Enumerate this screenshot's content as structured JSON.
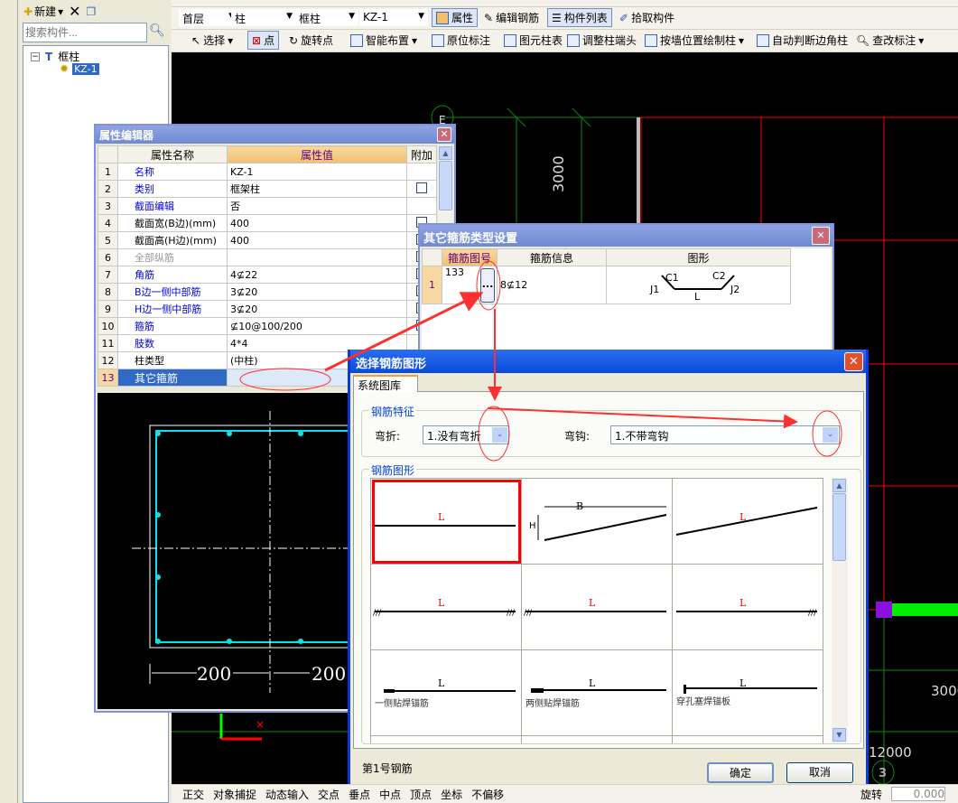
{
  "left_panel": {
    "new_label": "新建",
    "search_placeholder": "搜索构件...",
    "tree": {
      "root": "框柱",
      "child": "KZ-1"
    }
  },
  "toolbar1": {
    "floor": "首层",
    "type": "柱",
    "subtype": "框柱",
    "component": "KZ-1",
    "buttons": [
      "属性",
      "编辑钢筋",
      "构件列表",
      "拾取构件"
    ]
  },
  "toolbar2": {
    "buttons": [
      "选择",
      "点",
      "旋转点",
      "智能布置",
      "原位标注",
      "图元柱表",
      "调整柱端头",
      "按墙位置绘制柱",
      "自动判断边角柱",
      "查改标注"
    ]
  },
  "cad": {
    "axis_e": "E",
    "dim_3000_v": "3000",
    "dim_3000_h": "3000",
    "dim_12000": "12000",
    "axis_3": "3"
  },
  "property_editor": {
    "title": "属性编辑器",
    "headers": [
      "属性名称",
      "属性值",
      "附加"
    ],
    "rows": [
      {
        "n": "1",
        "name": "名称",
        "value": "KZ-1",
        "style": "blue",
        "check": false
      },
      {
        "n": "2",
        "name": "类别",
        "value": "框架柱",
        "style": "blue",
        "check": true
      },
      {
        "n": "3",
        "name": "截面编辑",
        "value": "否",
        "style": "blue",
        "check": false
      },
      {
        "n": "4",
        "name": "截面宽(B边)(mm)",
        "value": "400",
        "style": "",
        "check": true
      },
      {
        "n": "5",
        "name": "截面高(H边)(mm)",
        "value": "400",
        "style": "",
        "check": true
      },
      {
        "n": "6",
        "name": "全部纵筋",
        "value": "",
        "style": "grey",
        "check": true
      },
      {
        "n": "7",
        "name": "角筋",
        "value": "4⊈22",
        "style": "blue",
        "check": true
      },
      {
        "n": "8",
        "name": "B边一侧中部筋",
        "value": "3⊈20",
        "style": "blue",
        "check": true
      },
      {
        "n": "9",
        "name": "H边一侧中部筋",
        "value": "3⊈20",
        "style": "blue",
        "check": true
      },
      {
        "n": "10",
        "name": "箍筋",
        "value": "⊈10@100/200",
        "style": "blue",
        "check": true
      },
      {
        "n": "11",
        "name": "肢数",
        "value": "4*4",
        "style": "blue",
        "check": false
      },
      {
        "n": "12",
        "name": "柱类型",
        "value": "(中柱)",
        "style": "",
        "check": false
      },
      {
        "n": "13",
        "name": "其它箍筋",
        "value": "",
        "style": "selected",
        "check": false
      }
    ],
    "preview": {
      "dim_left": "200",
      "dim_right": "200"
    }
  },
  "stirrup_dialog": {
    "title": "其它箍筋类型设置",
    "headers": [
      "箍筋图号",
      "箍筋信息",
      "图形"
    ],
    "row": {
      "n": "1",
      "code": "133",
      "browse": "...",
      "info": "8⊈12",
      "shape_labels": {
        "c1": "C1",
        "c2": "C2",
        "j1": "J1",
        "j2": "J2",
        "l": "L"
      }
    }
  },
  "shape_dialog": {
    "title": "选择钢筋图形",
    "tab": "系统图库",
    "features_group": "钢筋特征",
    "bend_label": "弯折:",
    "bend_value": "1.没有弯折",
    "hook_label": "弯钩:",
    "hook_value": "1.不带弯钩",
    "shapes_group": "钢筋图形",
    "shapes": [
      {
        "label": "L",
        "caption": ""
      },
      {
        "label": "B",
        "caption": "",
        "h": "H"
      },
      {
        "label": "L",
        "caption": ""
      },
      {
        "label": "L",
        "caption": ""
      },
      {
        "label": "L",
        "caption": ""
      },
      {
        "label": "L",
        "caption": ""
      },
      {
        "label": "L",
        "caption": "一侧贴焊锚筋"
      },
      {
        "label": "L",
        "caption": "两侧贴焊锚筋"
      },
      {
        "label": "L",
        "caption": "穿孔塞焊锚板"
      }
    ],
    "selected_index": 0,
    "status": "第1号钢筋",
    "ok": "确定",
    "cancel": "取消"
  },
  "status_bar": {
    "items": [
      "正交",
      "对象捕捉",
      "动态输入",
      "交点",
      "垂点",
      "中点",
      "顶点",
      "坐标",
      "不偏移"
    ],
    "rotate_label": "旋转",
    "rotate_value": "0.000"
  },
  "colors": {
    "annotation": "#ff3030",
    "cad_bg": "#000000",
    "rebar": "#00e5ee",
    "selected_row": "#316ac5"
  }
}
